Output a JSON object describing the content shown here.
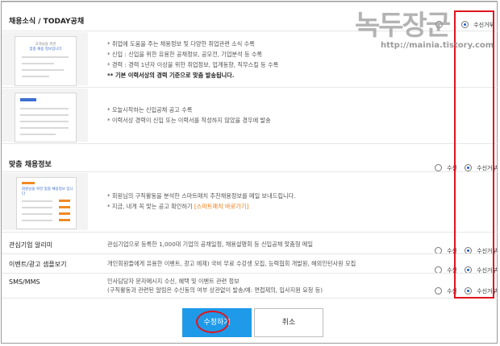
{
  "watermark": {
    "title": "녹두장군",
    "url": "http://mainia.tistory.com"
  },
  "sections": {
    "news": {
      "title": "채용소식 / TODAY공채",
      "thumb1": {
        "line1": "고객님을 위한",
        "line2": "맞춤 채용 정보입니다"
      },
      "desc1": [
        "* 취업에 도움을 주는 채용정보 및 다양한 취업관련 소식 수록",
        "* 신입 : 신입을 위한 유용한 공채정보, 공모전, 기업분석 등 수록",
        "* 경력 : 경력 1년자 이상을 위한 취업정보, 업계동향, 직무스킬 등 수록"
      ],
      "desc1_bold": "** 기본 이력서상의 경력 기준으로 맞춤 발송됩니다.",
      "desc2": [
        "* 오늘시작하는 신입공채 공고 수록",
        "* 이력서상 경력이 신입 또는 이력서를 작성하지 않았을 경우에 발송"
      ],
      "radio_on_label": "수신거부",
      "selected": "수신거부"
    },
    "custom": {
      "title": "맞춤 채용정보",
      "thumb_heading": "회원님을 위한 맞춤 채용정보 입니다",
      "desc_line1": "* 회원님의 구직활동을 분석한 스마트매치 추천채용정보를 메일 보내드립니다.",
      "desc_line2_prefix": "* 지금, 내게 꼭 맞는 공고 확인하기 ",
      "desc_line2_link": "[스마트매치 바로가기]",
      "radio_off_label": "수신",
      "radio_on_label": "수신거부",
      "selected": "수신거부"
    },
    "interest": {
      "title": "관심기업 알리미",
      "desc": "관심기업으로 등록한 1,000대 기업의 공채일정, 채용설명회 등 신입공채 맞춤형 메일",
      "radio_off_label": "수신",
      "radio_on_label": "수신거부",
      "selected": "수신거부"
    },
    "event": {
      "title": "이벤트/광고 샘플보기",
      "desc": "개인회원들에게 유용한 이벤트, 광고 에제) 국비 무료 수강생 모집, 능력협회 개발원, 해외인턴사원 모집",
      "radio_off_label": "수신",
      "radio_on_label": "수신거부",
      "selected": "수신거부"
    },
    "sms": {
      "title": "SMS/MMS",
      "desc_line1": "인사담당자 문자메시지 수신, 혜택 및 이벤트 관련 정보",
      "desc_line2": "(구직활동과 관련된 알림은 수신동의 여부 상관없이 발송/예: 면접제의, 입사지원 요청 등)",
      "radio_off_label": "수신",
      "radio_on_label": "수신거부",
      "selected": "수신거부"
    }
  },
  "buttons": {
    "submit": "수정하기",
    "cancel": "취소"
  },
  "colors": {
    "submit_bg": "#1f9ae8",
    "annotation_red": "#e0141e",
    "link_orange": "#f07a10",
    "radio_blue": "#1a5bd6"
  }
}
